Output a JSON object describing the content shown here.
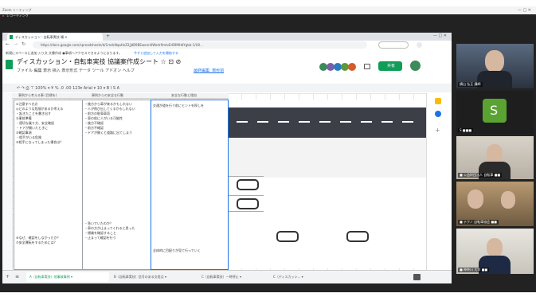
{
  "zoom": {
    "title": "Zoom ミーティング",
    "record_label": "レコーディング",
    "window_controls": "—  □  ✕"
  },
  "browser": {
    "tab_title": "ディスカッション - 自転車実技  場 ×",
    "new_tab": "+",
    "url": "https://docs.google.com/spreadsheets/d/1mdcNqaHxZ2jJdB9BEwenn0Wedr9mtvErB9MHdYgkb-1/U0...",
    "bookmark_bar": "新規にスペースに追加 入り文 文書作成 ●事項へアクセスできるようになります。",
    "bookmark_link": "今すぐ追加して入力を開始する"
  },
  "sheet": {
    "title": "ディスカッション・自転車実技  協議案作成シート  ☆ ⊡ ⊘",
    "menu": "ファイル  編集  表示  挿入  表示形式  データ  ツール  アドオン  ヘルプ",
    "last_edit": "最終編集: 数秒前",
    "share_label": "共有",
    "toolbar_text": "↶ ↷ ⎙ ⊤   100% ▾   ¥  %  .0  .00  123▾   Arial  ▾  10  ▾   B  I  S  A",
    "col_headers": [
      "事例から考える事 (目標を)",
      "事例からの安全な行動",
      "安全な行動と理由"
    ]
  },
  "columns": {
    "col1": [
      "①注意すべき点",
      "◎どのような危険があるか考える",
      "・起きたことを書き出す",
      "",
      "②事前準備",
      "・適切な乗り方、安全確認",
      "・ドアが開いたときに",
      "",
      "③確認事項",
      "・相手がいる危険",
      "",
      "⑤相手になってしまった場合は？"
    ],
    "col1_lower": [
      "⑥なぜ、確認をしなかったか？",
      "",
      "⑦安全運転をするためには？"
    ],
    "col2": [
      "・後方から車が来るかもしれない",
      "・人が飛び出してくるかもしれない",
      "・前方の駐車車両",
      "・車の前に人がいる可能性",
      "",
      "",
      "",
      "・後方不確認",
      "・前方不確認",
      "・ドアが開くと道路に出てしまう"
    ],
    "col2_lower": [
      "・急いでいたのか？",
      "・車の方が止まってくれると思った",
      "",
      "・標識を確認すること",
      "・止まって確認を行う"
    ],
    "col3_top": "交通が道を行う前にヒントを探しを",
    "col3_bottom": "全体的に目配りが見て行っていく"
  },
  "sheet_tabs": [
    "A（自転車実技）他事故事例 ▾",
    "B（自転車実技）信号のある交差点 ▾",
    "C（自転車実技）一時停止 ▾",
    "C（ディスカッシ... ▾"
  ],
  "participants": [
    {
      "name": "横山 弘正 講師"
    },
    {
      "name": "S",
      "label": "S ■■■"
    },
    {
      "name": "■ 公益財団法人 自転車 ■■"
    },
    {
      "name": "■ テクノ 自転車協会 ■■"
    },
    {
      "name": "■ 神奈川 大学 ■■"
    }
  ],
  "colors": {
    "accent": "#1a73e8",
    "sheets_green": "#0f9d58",
    "zoom_bg": "#222222",
    "road": "#3d3f48"
  }
}
